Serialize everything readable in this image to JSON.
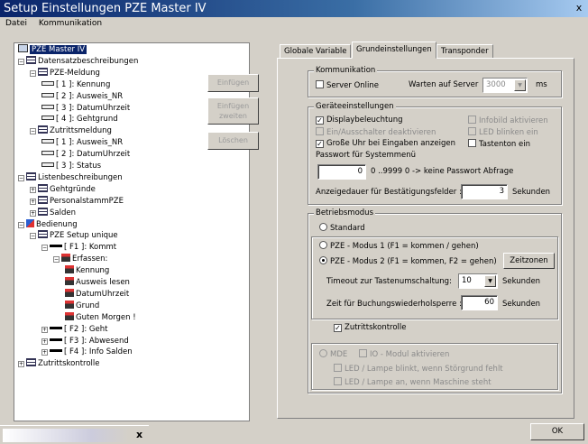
{
  "window": {
    "title": "Setup Einstellungen PZE Master IV",
    "close_glyph": "x"
  },
  "menu": [
    "Datei",
    "Kommunikation"
  ],
  "tree": [
    {
      "label": "PZE Master IV",
      "icon": "pc-icon",
      "selected": true
    },
    {
      "label": "Datensatzbeschreibungen",
      "icon": "table-icon",
      "expander": "−"
    },
    {
      "label": "PZE-Meldung",
      "icon": "table-icon",
      "expander": "−"
    },
    {
      "label": "[ 1 ]: Kennung",
      "icon": "field-icon"
    },
    {
      "label": "[ 2 ]: Ausweis_NR",
      "icon": "field-icon"
    },
    {
      "label": "[ 3 ]: DatumUhrzeit",
      "icon": "field-icon"
    },
    {
      "label": "[ 4 ]: Gehtgrund",
      "icon": "field-icon"
    },
    {
      "label": "Zutrittsmeldung",
      "icon": "table-icon",
      "expander": "−"
    },
    {
      "label": "[ 1 ]: Ausweis_NR",
      "icon": "field-icon"
    },
    {
      "label": "[ 2 ]: DatumUhrzeit",
      "icon": "field-icon"
    },
    {
      "label": "[ 3 ]: Status",
      "icon": "field-icon"
    },
    {
      "label": "Listenbeschreibungen",
      "icon": "table-icon",
      "expander": "−"
    },
    {
      "label": "Gehtgründe",
      "icon": "table-icon",
      "expander": "+"
    },
    {
      "label": "PersonalstammPZE",
      "icon": "table-icon",
      "expander": "+"
    },
    {
      "label": "Salden",
      "icon": "table-icon",
      "expander": "+"
    },
    {
      "label": "Bedienung",
      "icon": "bedienung-icon",
      "expander": "−"
    },
    {
      "label": "PZE Setup unique",
      "icon": "table-icon",
      "expander": "−"
    },
    {
      "label": "[ F1 ]: Kommt",
      "icon": "key-icon",
      "expander": "−"
    },
    {
      "label": "Erfassen:",
      "icon": "erfassen-icon",
      "expander": "−"
    },
    {
      "label": "Kennung",
      "icon": "erfassen-icon"
    },
    {
      "label": "Ausweis lesen",
      "icon": "erfassen-icon"
    },
    {
      "label": "DatumUhrzeit",
      "icon": "erfassen-icon"
    },
    {
      "label": "Grund",
      "icon": "erfassen-icon"
    },
    {
      "label": "Guten Morgen !",
      "icon": "erfassen-icon"
    },
    {
      "label": "[ F2 ]: Geht",
      "icon": "key-icon",
      "expander": "+"
    },
    {
      "label": "[ F3 ]: Abwesend",
      "icon": "key-icon",
      "expander": "+"
    },
    {
      "label": "[ F4 ]: Info Salden",
      "icon": "key-icon",
      "expander": "+"
    },
    {
      "label": "Zutrittskontrolle",
      "icon": "table-icon",
      "expander": "+"
    }
  ],
  "middle_buttons": {
    "einfuegen": "Einfügen",
    "einfuegen2_line1": "Einfügen",
    "einfuegen2_line2": "zweiten",
    "loeschen": "Löschen"
  },
  "tabs": [
    "Globale Variable",
    "Grundeinstellungen",
    "Transponder"
  ],
  "active_tab": "Grundeinstellungen",
  "kommunikation": {
    "title": "Kommunikation",
    "server_online": "Server Online",
    "warten_label": "Warten auf Server",
    "warten_value": "3000",
    "unit": "ms"
  },
  "geraete": {
    "title": "Geräteeinstellungen",
    "displaybeleuchtung": "Displaybeleuchtung",
    "ein_aus": "Ein/Ausschalter deaktivieren",
    "grosse_uhr": "Große Uhr bei Eingaben anzeigen",
    "infobild": "Infobild aktivieren",
    "led_blinken": "LED blinken ein",
    "tastenton": "Tastenton ein",
    "passwort_label": "Passwort für Systemmenü",
    "passwort_value": "0",
    "passwort_hint": "0 ..9999   0 -> keine Passwort Abfrage",
    "anzeigedauer_label": "Anzeigedauer für Bestätigungsfelder :",
    "anzeigedauer_value": "3",
    "sekunden": "Sekunden"
  },
  "betrieb": {
    "title": "Betriebsmodus",
    "standard": "Standard",
    "modus1": "PZE - Modus 1 (F1 = kommen / gehen)",
    "modus2": "PZE - Modus 2 (F1 = kommen, F2 = gehen)",
    "zeitzonen": "Zeitzonen",
    "timeout_label": "Timeout zur Tastenumschaltung:",
    "timeout_value": "10",
    "zeit_label": "Zeit für Buchungswiederholsperre :",
    "zeit_value": "60",
    "sekunden": "Sekunden",
    "zutrittskontrolle": "Zutrittskontrolle",
    "mde": "MDE",
    "io_modul": "IO - Modul aktivieren",
    "led1": "LED / Lampe blinkt, wenn Störgrund fehlt",
    "led2": "LED / Lampe an, wenn Maschine steht"
  },
  "ok": "OK",
  "check": "✓"
}
